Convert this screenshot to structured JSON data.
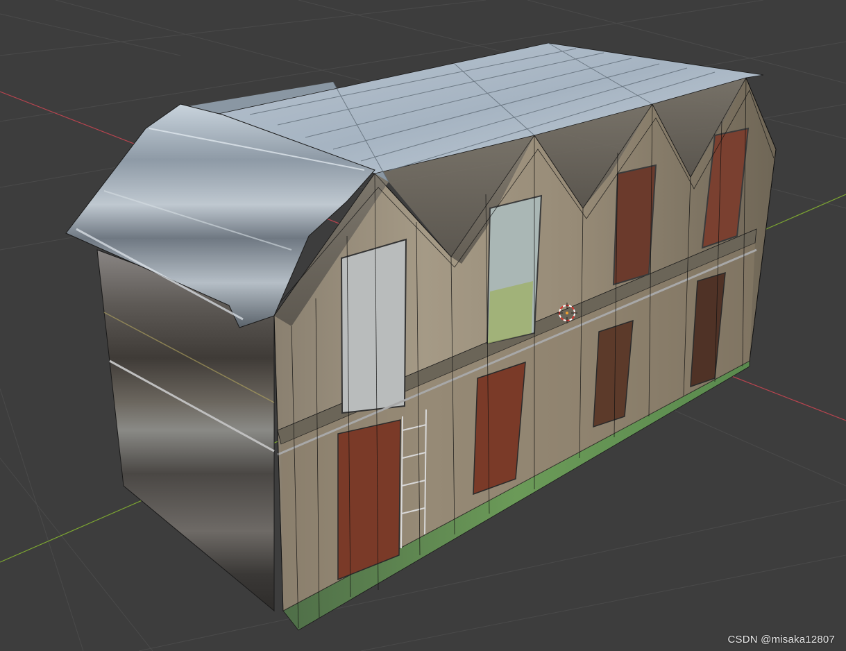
{
  "viewport": {
    "background": "#3d3d3d",
    "grid_color": "#484848",
    "x_axis_color": "#c4434f",
    "y_axis_color": "#7ea831"
  },
  "scene": {
    "object": "building-mesh",
    "wireframe": true,
    "origin_marker": "3d-cursor-icon"
  },
  "colors": {
    "roof_metal": "#aab8c4",
    "wall_plaster": "#9a8f7c",
    "door_rust": "#7a3a28",
    "grass": "#5e8a4e",
    "wire": "#1a1a1a"
  },
  "watermark": {
    "text": "CSDN @misaka12807"
  }
}
